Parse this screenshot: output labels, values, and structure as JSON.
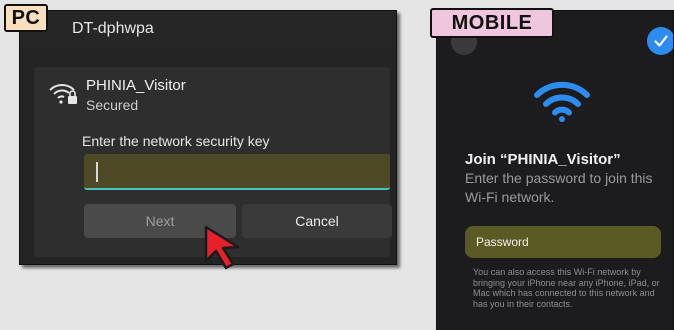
{
  "pc": {
    "tag": "PC",
    "previous_network": "DT-dphwpa",
    "network_name": "PHINIA_Visitor",
    "network_status": "Secured",
    "key_label": "Enter the network security key",
    "key_value": "",
    "next_label": "Next",
    "cancel_label": "Cancel"
  },
  "mobile": {
    "tag": "MOBILE",
    "title": "Join “PHINIA_Visitor”",
    "subtitle": "Enter the password to join this Wi-Fi network.",
    "password_placeholder": "Password",
    "help_text": "You can also access this Wi-Fi network by bringing your iPhone near any iPhone, iPad, or Mac which has connected to this network and has you in their contacts."
  },
  "colors": {
    "highlight_field": "#4f4a26",
    "input_accent": "#4bc3c6",
    "ios_blue": "#2c8cf0",
    "cursor_red": "#e8202a"
  },
  "icons": [
    "wifi-lock-icon",
    "text-caret",
    "cursor-arrow-icon",
    "wifi-icon",
    "checkmark-icon",
    "close-icon"
  ]
}
